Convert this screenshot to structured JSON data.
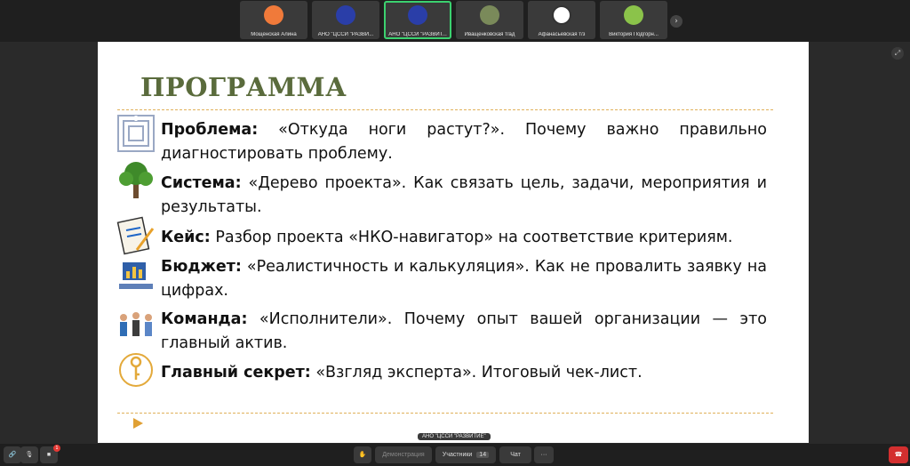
{
  "participants": [
    {
      "name": "Мощенская Алина",
      "color": "#f07a3a"
    },
    {
      "name": "АНО \"ЦССИ \"РАЗВИ...",
      "color": "#2a3ea8"
    },
    {
      "name": "АНО \"ЦССИ \"РАЗВИТ...",
      "color": "#2a3ea8"
    },
    {
      "name": "Иващенковская т/ад",
      "color": "#7a8a5a"
    },
    {
      "name": "Афанасьевская т/з",
      "color": "#ffffff"
    },
    {
      "name": "Виктория Подгорн...",
      "color": "#8bc34a"
    }
  ],
  "slide": {
    "title": "ПРОГРАММА",
    "items": [
      {
        "label": "Проблема:",
        "text": " «Откуда ноги растут?». Почему важно правильно диагностировать проблему."
      },
      {
        "label": "Система:",
        "text": " «Дерево проекта». Как связать цель, задачи, мероприятия и результаты."
      },
      {
        "label": "Кейс:",
        "text": " Разбор проекта «НКО-навигатор» на соответствие критериям."
      },
      {
        "label": "Бюджет:",
        "text": " «Реалистичность и калькуляция». Как не провалить заявку на цифрах."
      },
      {
        "label": "Команда:",
        "text": " «Исполнители». Почему опыт вашей организации — это главный актив."
      },
      {
        "label": "Главный секрет:",
        "text": " «Взгляд эксперта». Итоговый чек-лист."
      }
    ]
  },
  "speaker_label": "АНО \"ЦССИ \"РАЗВИТИЕ\"",
  "toolbar": {
    "share_label": "Демонстрация",
    "participants_label": "Участники",
    "participants_count": "14",
    "chat_label": "Чат",
    "more_label": "···",
    "hand_badge": "1"
  }
}
